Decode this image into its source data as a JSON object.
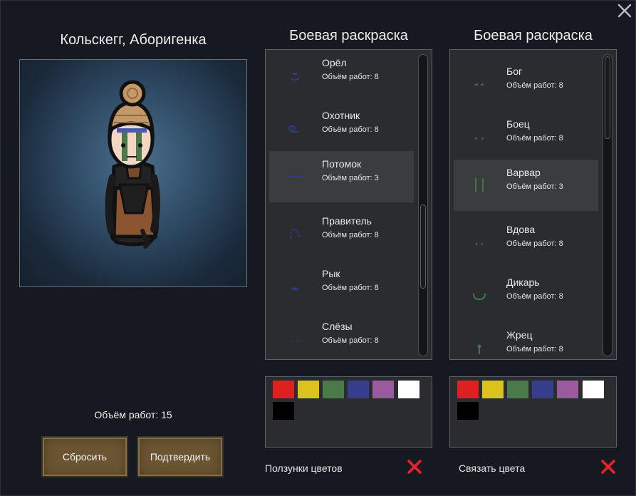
{
  "pawn": {
    "title": "Кольскегг, Аборигенка",
    "work_total": "Объём работ: 15"
  },
  "buttons": {
    "reset": "Сбросить",
    "confirm": "Подтвердить"
  },
  "column_left": {
    "title": "Боевая раскраска",
    "items": [
      {
        "name": "Орёл",
        "work": "Объём работ: 8",
        "icon": "eagle-paint-icon"
      },
      {
        "name": "Охотник",
        "work": "Объём работ: 8",
        "icon": "hunter-paint-icon"
      },
      {
        "name": "Потомок",
        "work": "Объём работ: 3",
        "icon": "descendant-paint-icon"
      },
      {
        "name": "Правитель",
        "work": "Объём работ: 8",
        "icon": "ruler-paint-icon"
      },
      {
        "name": "Рык",
        "work": "Объём работ: 8",
        "icon": "roar-paint-icon"
      },
      {
        "name": "Слёзы",
        "work": "Объём работ: 8",
        "icon": "tears-paint-icon"
      }
    ],
    "footer_label": "Ползунки цветов"
  },
  "column_right": {
    "title": "Боевая раскраска",
    "items": [
      {
        "name": "Бог",
        "work": "Объём работ: 8",
        "icon": "god-paint-icon"
      },
      {
        "name": "Боец",
        "work": "Объём работ: 8",
        "icon": "fighter-paint-icon"
      },
      {
        "name": "Варвар",
        "work": "Объём работ: 3",
        "icon": "barbarian-paint-icon"
      },
      {
        "name": "Вдова",
        "work": "Объём работ: 8",
        "icon": "widow-paint-icon"
      },
      {
        "name": "Дикарь",
        "work": "Объём работ: 8",
        "icon": "savage-paint-icon"
      },
      {
        "name": "Жрец",
        "work": "Объём работ: 8",
        "icon": "priest-paint-icon"
      }
    ],
    "footer_label": "Связать цвета"
  },
  "colors": {
    "palette": [
      "#e0201f",
      "#ddc21d",
      "#4a7a4a",
      "#353d8c",
      "#9a5a9c",
      "#ffffff",
      "#000000"
    ],
    "left_paint": "#2f3a8c",
    "right_paint": "#3f7a45",
    "accent_x": "#e8222a",
    "button_brown": "#6a5431"
  }
}
